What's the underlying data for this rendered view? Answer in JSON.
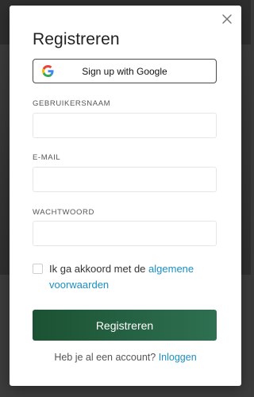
{
  "modal": {
    "title": "Registreren"
  },
  "google": {
    "label": "Sign up with Google",
    "icon": "google-g-icon",
    "colors": {
      "blue": "#4285F4",
      "red": "#EA4335",
      "yellow": "#FBBC05",
      "green": "#34A853"
    }
  },
  "fields": {
    "username_label": "GEBRUIKERSNAAM",
    "username_value": "",
    "email_label": "E-MAIL",
    "email_value": "",
    "password_label": "WACHTWOORD",
    "password_value": ""
  },
  "terms": {
    "checked": false,
    "text": "Ik ga akkoord met de",
    "link_text": "algemene voorwaarden"
  },
  "submit": {
    "label": "Registreren",
    "color_start": "#1b5233",
    "color_end": "#2e7051"
  },
  "login": {
    "text": "Heb je al een account?",
    "link_text": "Inloggen"
  },
  "close": {
    "icon": "close-icon"
  },
  "theme": {
    "link_color": "#1a8fc4"
  }
}
